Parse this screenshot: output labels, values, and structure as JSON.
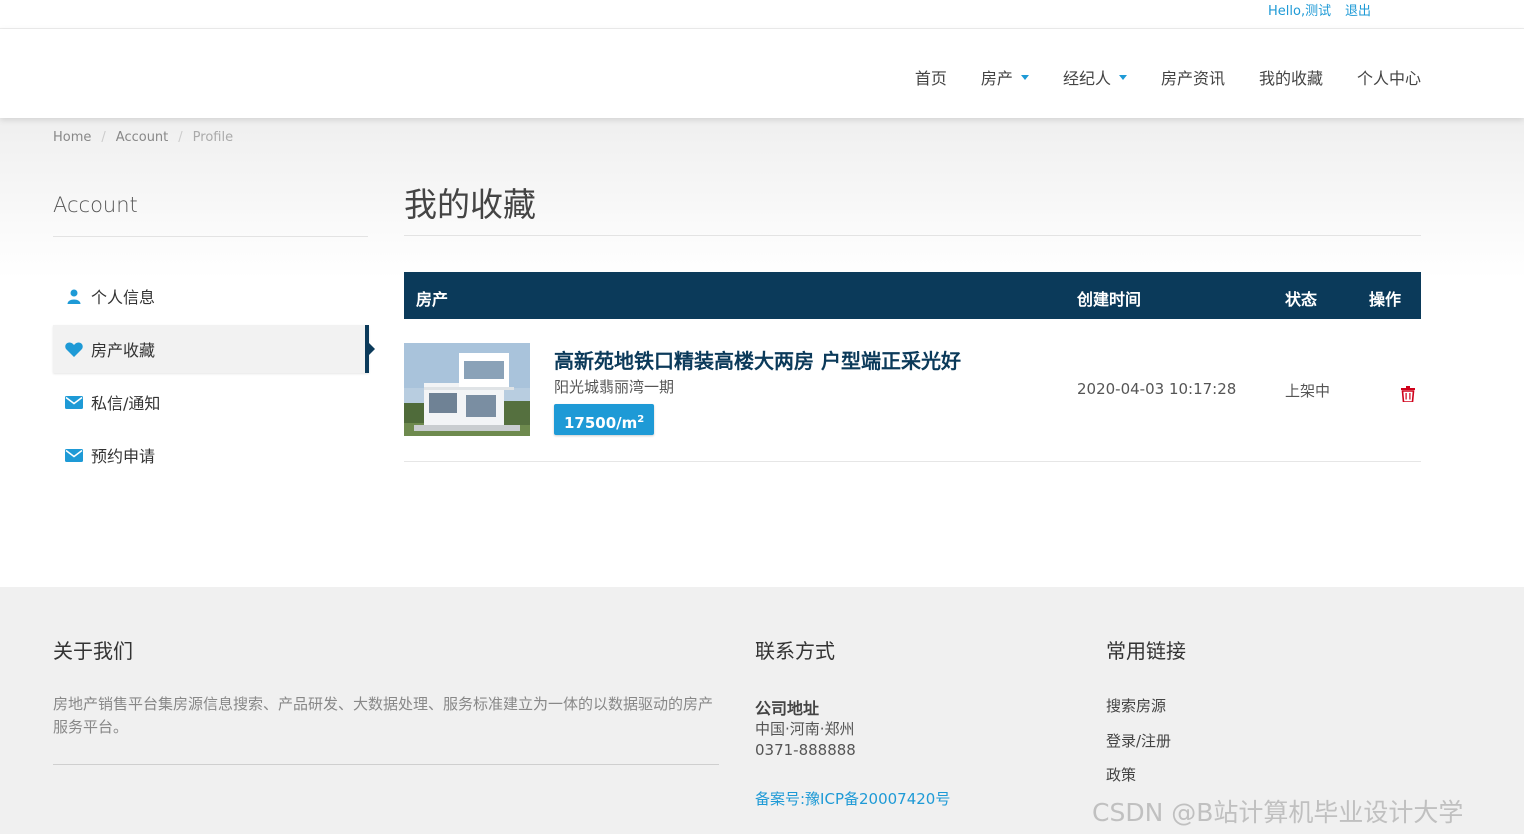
{
  "topbar": {
    "hello": "Hello,测试",
    "logout": "退出"
  },
  "nav": [
    {
      "label": "首页",
      "dropdown": false
    },
    {
      "label": "房产",
      "dropdown": true
    },
    {
      "label": "经纪人",
      "dropdown": true
    },
    {
      "label": "房产资讯",
      "dropdown": false
    },
    {
      "label": "我的收藏",
      "dropdown": false
    },
    {
      "label": "个人中心",
      "dropdown": false
    }
  ],
  "breadcrumb": [
    "Home",
    "Account",
    "Profile"
  ],
  "sidebar": {
    "title": "Account",
    "items": [
      {
        "label": "个人信息",
        "icon": "user-icon"
      },
      {
        "label": "房产收藏",
        "icon": "heart-icon",
        "active": true
      },
      {
        "label": "私信/通知",
        "icon": "envelope-icon"
      },
      {
        "label": "预约申请",
        "icon": "envelope-icon"
      }
    ]
  },
  "main": {
    "title": "我的收藏",
    "columns": {
      "property": "房产",
      "created": "创建时间",
      "status": "状态",
      "action": "操作"
    },
    "rows": [
      {
        "title": "高新苑地铁口精装高楼大两房 户型端正采光好",
        "subtitle": "阳光城翡丽湾一期",
        "price": "17500/m",
        "price_sup": "2",
        "created": "2020-04-03 10:17:28",
        "status": "上架中"
      }
    ]
  },
  "footer": {
    "about": {
      "title": "关于我们",
      "text": "房地产销售平台集房源信息搜索、产品研发、大数据处理、服务标准建立为一体的以数据驱动的房产服务平台。"
    },
    "contact": {
      "title": "联系方式",
      "address_label": "公司地址",
      "address": "中国·河南·郑州",
      "phone": "0371-888888",
      "icp": "备案号:豫ICP备20007420号"
    },
    "links": {
      "title": "常用链接",
      "items": [
        "搜索房源",
        "登录/注册",
        "政策"
      ]
    },
    "watermark": "CSDN @B站计算机毕业设计大学"
  },
  "colors": {
    "accent": "#1e9ad6",
    "navy": "#0b3a5a",
    "delete": "#d0021b"
  }
}
